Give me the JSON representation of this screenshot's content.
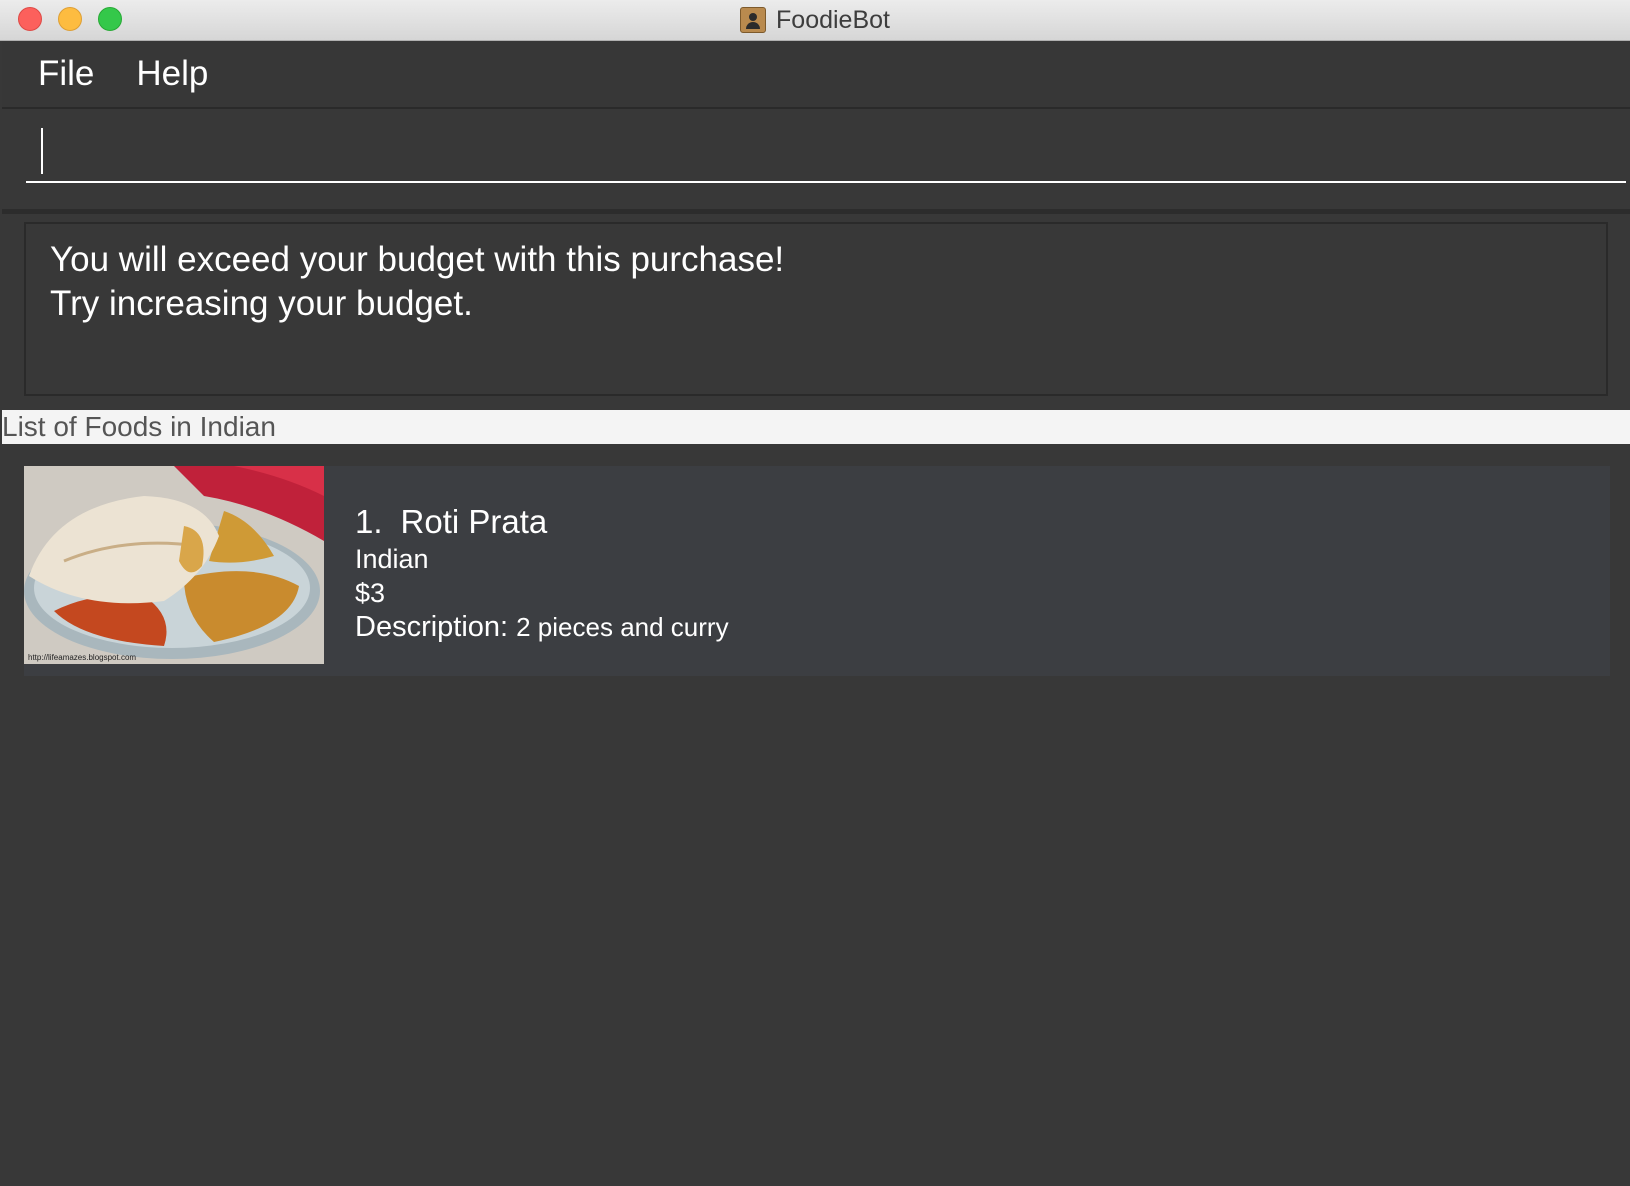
{
  "window": {
    "title": "FoodieBot"
  },
  "menu": {
    "items": [
      "File",
      "Help"
    ]
  },
  "command": {
    "value": "",
    "placeholder": ""
  },
  "result": {
    "lines": [
      "You will exceed your budget with this purchase!",
      "Try increasing your budget."
    ]
  },
  "list": {
    "header": "List of Foods in Indian",
    "foods": [
      {
        "index": "1.",
        "name": "Roti Prata",
        "cuisine": "Indian",
        "price": "$3",
        "description_label": "Description:",
        "description": "2 pieces and curry",
        "photo_watermark": "http://lifeamazes.blogspot.com"
      }
    ]
  },
  "colors": {
    "background": "#383838",
    "card": "#3c3e42",
    "text": "#ffffff",
    "header_bg": "#f4f4f4",
    "close": "#fc605c",
    "minimize": "#fdbc40",
    "maximize": "#34c84a"
  }
}
